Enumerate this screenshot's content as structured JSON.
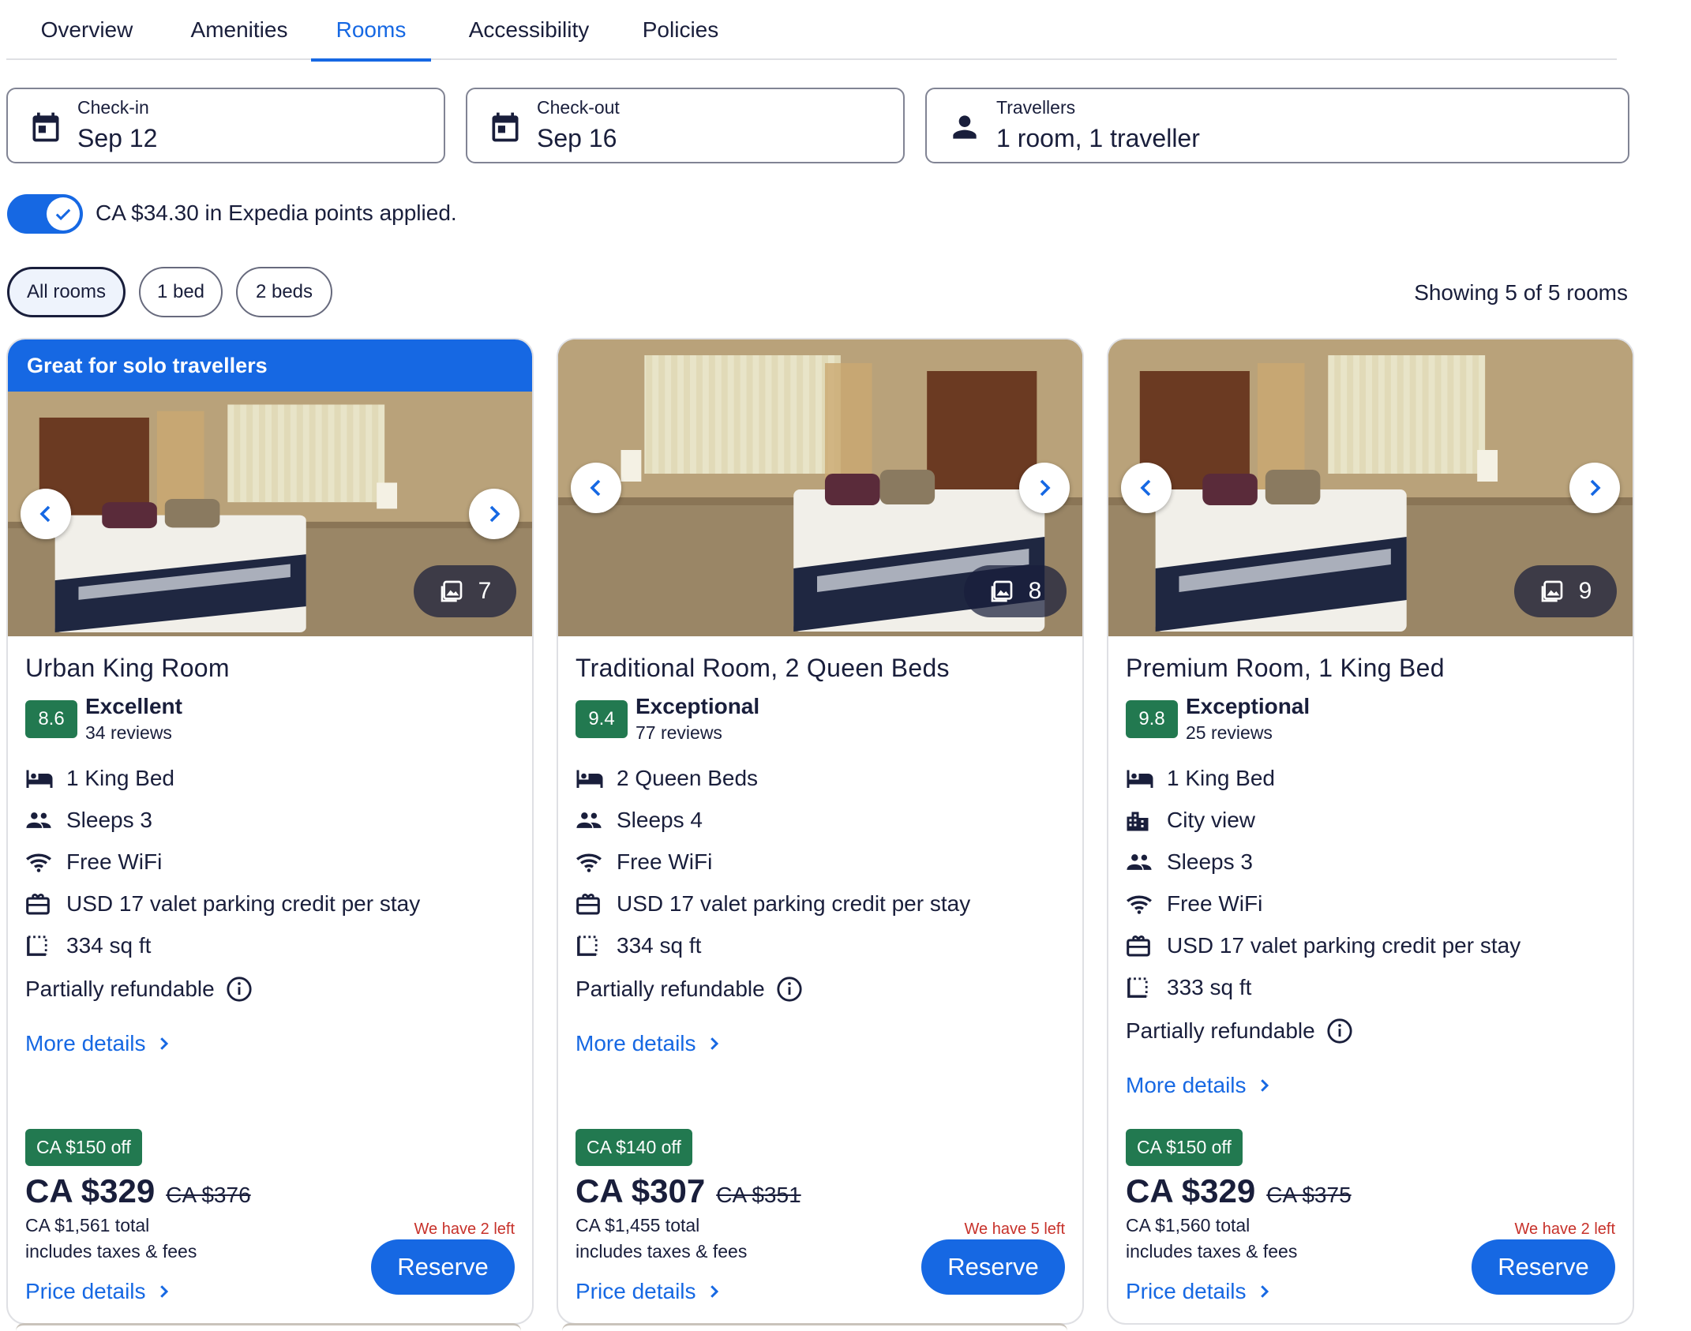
{
  "tabs": [
    {
      "label": "Overview"
    },
    {
      "label": "Amenities"
    },
    {
      "label": "Rooms"
    },
    {
      "label": "Accessibility"
    },
    {
      "label": "Policies"
    }
  ],
  "search": {
    "checkin": {
      "label": "Check-in",
      "value": "Sep 12",
      "icon": "calendar-icon"
    },
    "checkout": {
      "label": "Check-out",
      "value": "Sep 16",
      "icon": "calendar-icon"
    },
    "travellers": {
      "label": "Travellers",
      "value": "1 room, 1 traveller",
      "icon": "person-icon"
    }
  },
  "points": {
    "text": "CA $34.30 in Expedia points applied.",
    "enabled": true
  },
  "filters": {
    "chips": [
      {
        "label": "All rooms",
        "active": true
      },
      {
        "label": "1 bed",
        "active": false
      },
      {
        "label": "2 beds",
        "active": false
      }
    ],
    "showing": "Showing 5 of 5 rooms"
  },
  "colors": {
    "accent": "#1668e3",
    "rating": "#227950",
    "urgent": "#c7312a",
    "text": "#191e3b"
  },
  "rooms": [
    {
      "banner": "Great for solo travellers",
      "photo_count": "7",
      "name": "Urban King Room",
      "score": "8.6",
      "score_word": "Excellent",
      "reviews": "34 reviews",
      "features": [
        {
          "icon": "bed-icon",
          "text": "1 King Bed"
        },
        {
          "icon": "people-icon",
          "text": "Sleeps 3"
        },
        {
          "icon": "wifi-icon",
          "text": "Free WiFi"
        },
        {
          "icon": "parking-credit-icon",
          "text": "USD 17 valet parking credit per stay"
        },
        {
          "icon": "area-icon",
          "text": "334 sq ft"
        }
      ],
      "refund": "Partially refundable",
      "more_details": "More details",
      "discount": "CA $150 off",
      "price": "CA $329",
      "old_price": "CA $376",
      "total": "CA $1,561 total",
      "taxes": "includes taxes & fees",
      "availability": "We have 2 left",
      "price_details": "Price details",
      "reserve": "Reserve"
    },
    {
      "banner": "",
      "photo_count": "8",
      "name": "Traditional Room, 2 Queen Beds",
      "score": "9.4",
      "score_word": "Exceptional",
      "reviews": "77 reviews",
      "features": [
        {
          "icon": "bed-icon",
          "text": "2 Queen Beds"
        },
        {
          "icon": "people-icon",
          "text": "Sleeps 4"
        },
        {
          "icon": "wifi-icon",
          "text": "Free WiFi"
        },
        {
          "icon": "parking-credit-icon",
          "text": "USD 17 valet parking credit per stay"
        },
        {
          "icon": "area-icon",
          "text": "334 sq ft"
        }
      ],
      "refund": "Partially refundable",
      "more_details": "More details",
      "discount": "CA $140 off",
      "price": "CA $307",
      "old_price": "CA $351",
      "total": "CA $1,455 total",
      "taxes": "includes taxes & fees",
      "availability": "We have 5 left",
      "price_details": "Price details",
      "reserve": "Reserve"
    },
    {
      "banner": "",
      "photo_count": "9",
      "name": "Premium Room, 1 King Bed",
      "score": "9.8",
      "score_word": "Exceptional",
      "reviews": "25 reviews",
      "features": [
        {
          "icon": "bed-icon",
          "text": "1 King Bed"
        },
        {
          "icon": "city-icon",
          "text": "City view"
        },
        {
          "icon": "people-icon",
          "text": "Sleeps 3"
        },
        {
          "icon": "wifi-icon",
          "text": "Free WiFi"
        },
        {
          "icon": "parking-credit-icon",
          "text": "USD 17 valet parking credit per stay"
        },
        {
          "icon": "area-icon",
          "text": "333 sq ft"
        }
      ],
      "refund": "Partially refundable",
      "more_details": "More details",
      "discount": "CA $150 off",
      "price": "CA $329",
      "old_price": "CA $375",
      "total": "CA $1,560 total",
      "taxes": "includes taxes & fees",
      "availability": "We have 2 left",
      "price_details": "Price details",
      "reserve": "Reserve"
    }
  ]
}
